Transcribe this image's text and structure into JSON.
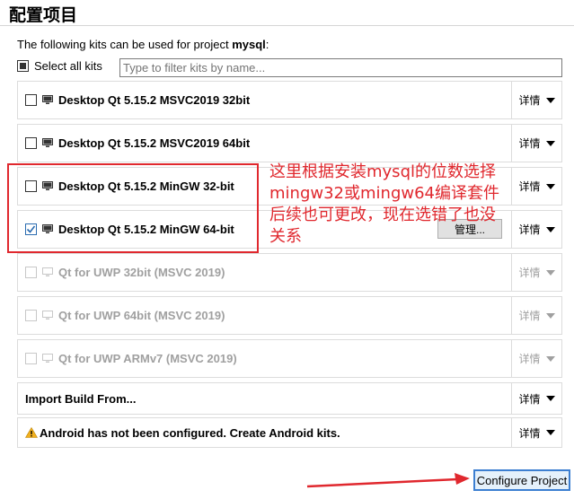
{
  "page_title": "配置项目",
  "subtitle_prefix": "The following kits can be used for project ",
  "project_name": "mysql",
  "subtitle_suffix": ":",
  "select_all_label": "Select all kits",
  "filter_placeholder": "Type to filter kits by name...",
  "details_label": "详情",
  "kits": [
    {
      "label": "Desktop Qt 5.15.2 MSVC2019 32bit",
      "checked": false,
      "enabled": true
    },
    {
      "label": "Desktop Qt 5.15.2 MSVC2019 64bit",
      "checked": false,
      "enabled": true
    },
    {
      "label": "Desktop Qt 5.15.2 MinGW 32-bit",
      "checked": false,
      "enabled": true
    },
    {
      "label": "Desktop Qt 5.15.2 MinGW 64-bit",
      "checked": true,
      "enabled": true
    },
    {
      "label": "Qt  for UWP 32bit (MSVC 2019)",
      "checked": false,
      "enabled": false
    },
    {
      "label": "Qt  for UWP 64bit (MSVC 2019)",
      "checked": false,
      "enabled": false
    },
    {
      "label": "Qt  for UWP ARMv7 (MSVC 2019)",
      "checked": false,
      "enabled": false
    }
  ],
  "manage_label": "管理...",
  "import_label": "Import Build From...",
  "android_label": "Android has not been configured. Create Android kits.",
  "annotation_lines": [
    "这里根据安装mysql的位数选择",
    "mingw32或mingw64编译套件",
    "后续也可更改，现在选错了也没",
    "关系"
  ],
  "configure_label": "Configure Project",
  "colors": {
    "annotation": "#e0282e",
    "accent": "#3c7fd1"
  }
}
